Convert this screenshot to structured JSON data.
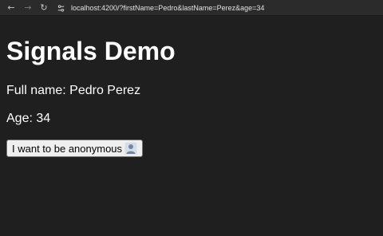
{
  "browser": {
    "url": "localhost:4200/?firstName=Pedro&lastName=Perez&age=34",
    "back_icon": "←",
    "forward_icon": "→",
    "reload_icon": "↻"
  },
  "page": {
    "title": "Signals Demo",
    "full_name_text": "Full name: Pedro Perez",
    "age_text": "Age: 34",
    "anonymous_button_label": "I want to be anonymous",
    "anonymous_button_icon": "bust-in-silhouette-icon"
  }
}
